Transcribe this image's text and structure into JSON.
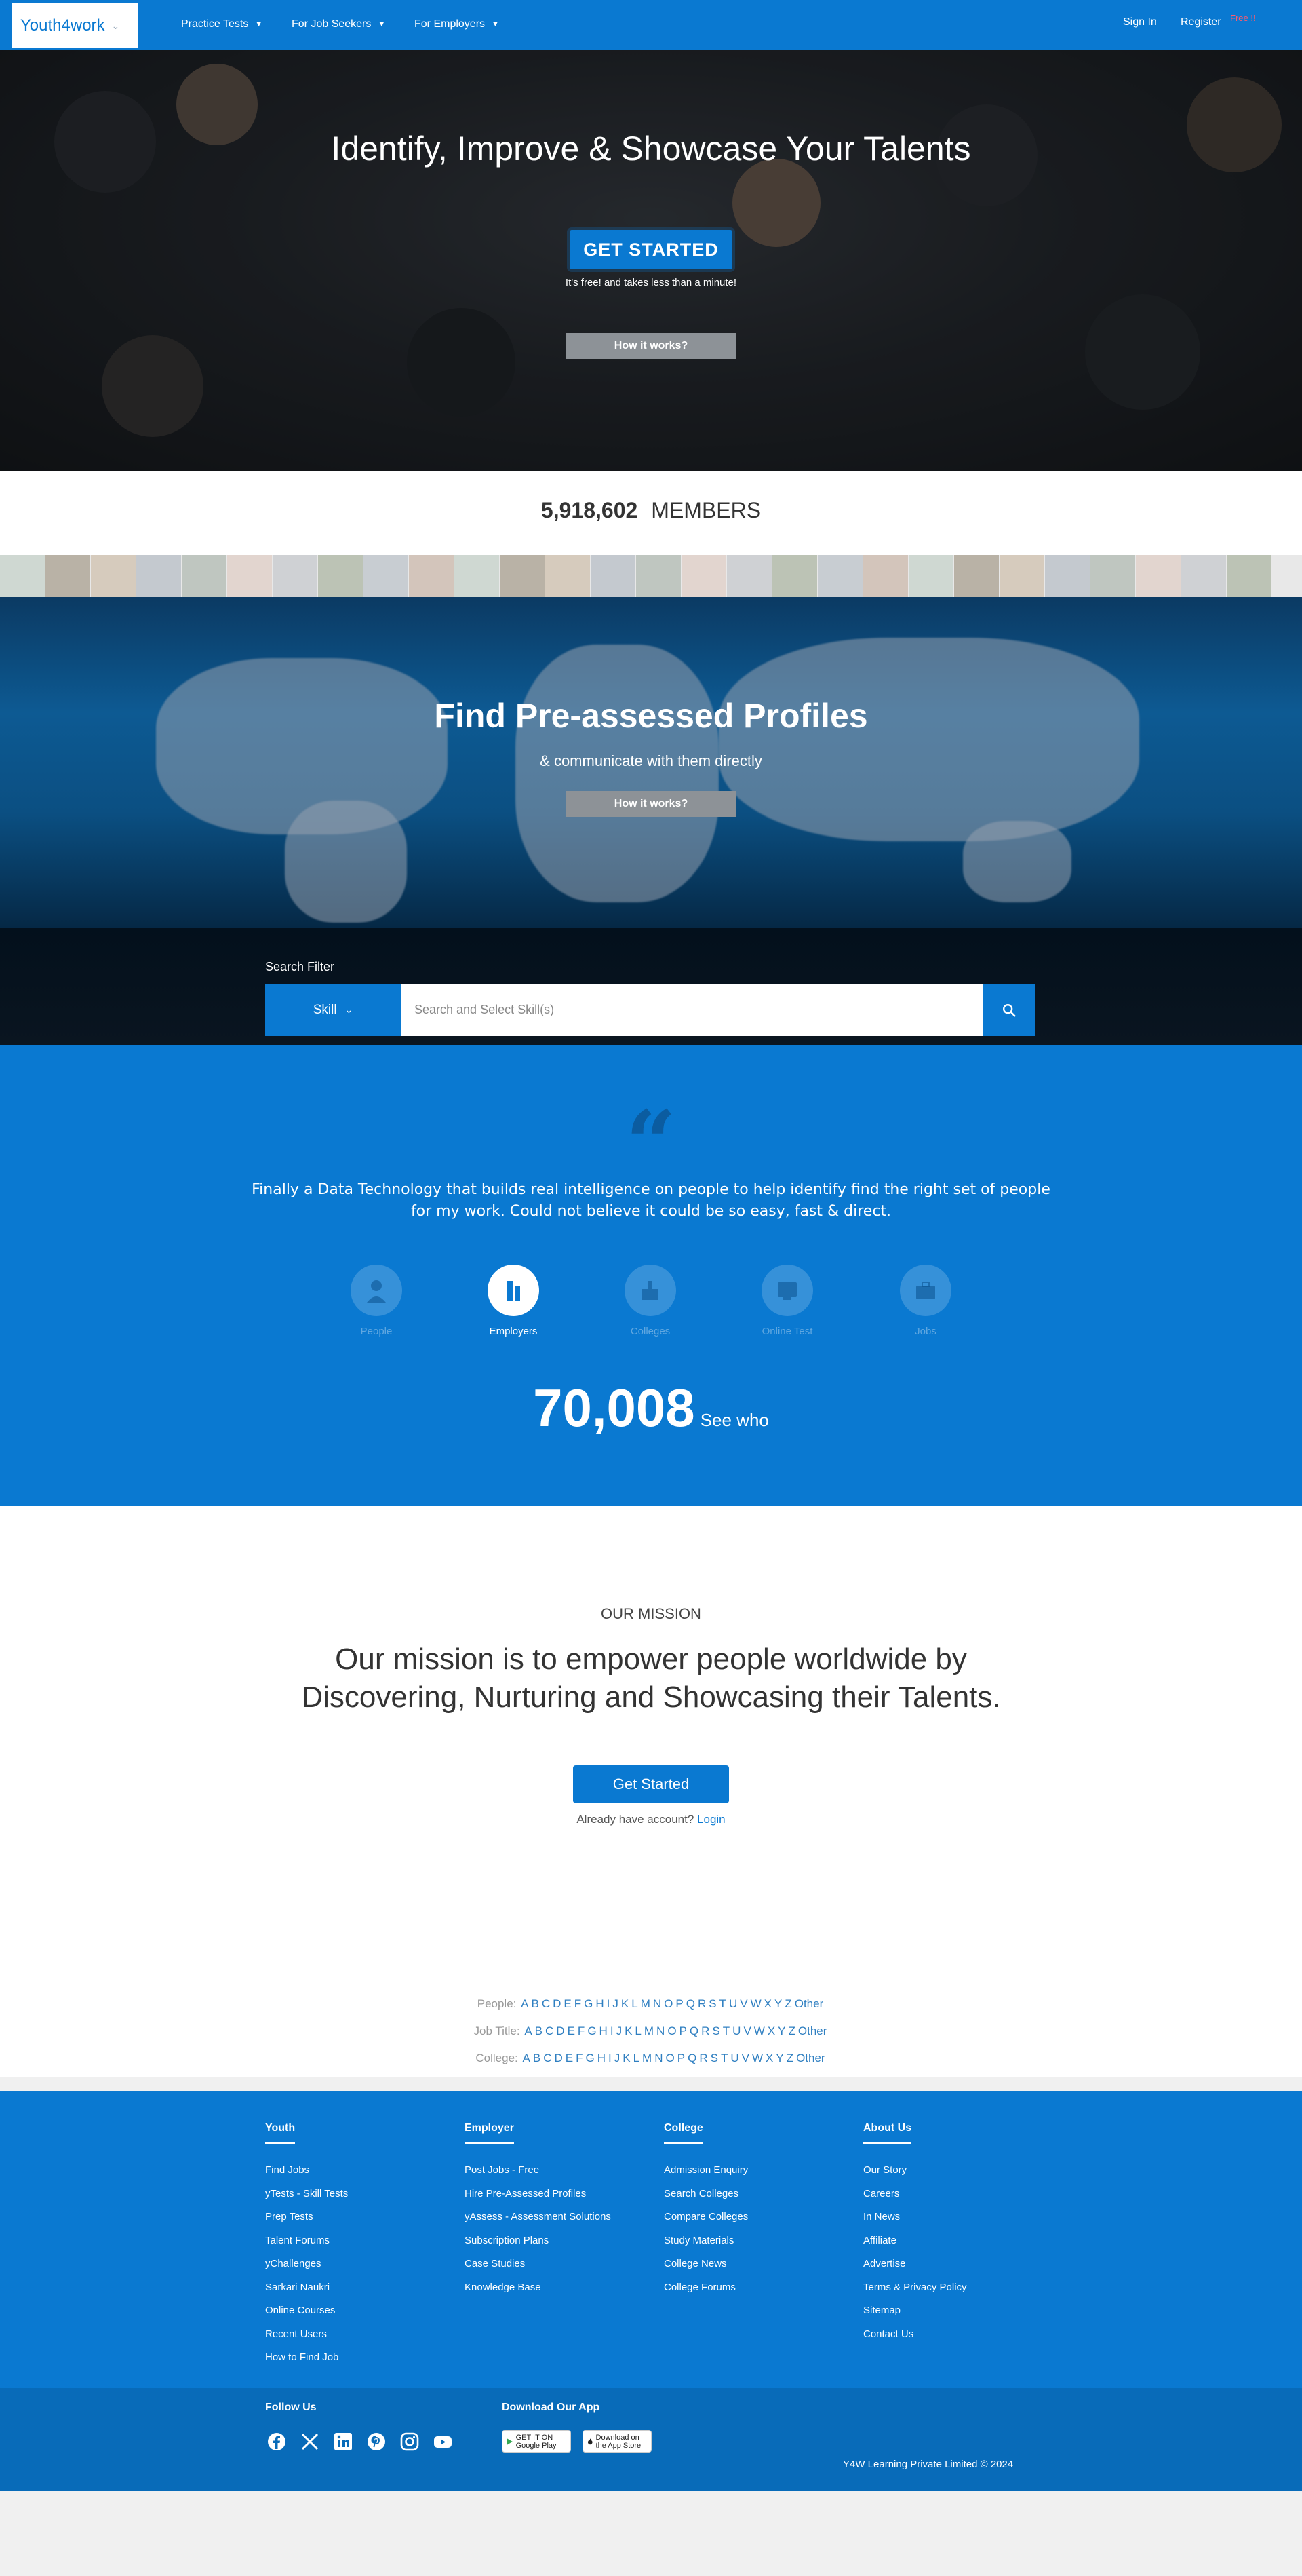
{
  "nav": {
    "logo": "Youth4work",
    "menu": [
      "Practice Tests",
      "For Job Seekers",
      "For Employers"
    ],
    "sign_in": "Sign In",
    "register": "Register",
    "free_tag": "Free !!"
  },
  "hero": {
    "title": "Identify, Improve & Showcase Your Talents",
    "cta": "GET STARTED",
    "subtitle": "It's free! and takes less than a minute!",
    "how_it_works": "How it works?"
  },
  "members": {
    "count": "5,918,602",
    "label": "MEMBERS"
  },
  "profiles": {
    "title": "Find Pre-assessed Profiles",
    "subtitle": "& communicate with them directly",
    "how_it_works": "How it works?"
  },
  "search": {
    "label": "Search Filter",
    "filter": "Skill",
    "placeholder": "Search and Select Skill(s)"
  },
  "testimonial": {
    "quote": "Finally a Data Technology that builds real intelligence on people to help identify find the right set of people for my work. Could not believe it could be so easy, fast & direct.",
    "categories": [
      "People",
      "Employers",
      "Colleges",
      "Online Test",
      "Jobs"
    ],
    "active_category": "Employers",
    "count": "70,008",
    "see_who": "See who"
  },
  "mission": {
    "kicker": "OUR MISSION",
    "line1": "Our mission is to empower people worldwide by",
    "line2": "Discovering, Nurturing and Showcasing their Talents.",
    "cta": "Get Started",
    "already": "Already have account?",
    "login": "Login"
  },
  "directory": {
    "rows": [
      {
        "label": "People:",
        "letters": [
          "A",
          "B",
          "C",
          "D",
          "E",
          "F",
          "G",
          "H",
          "I",
          "J",
          "K",
          "L",
          "M",
          "N",
          "O",
          "P",
          "Q",
          "R",
          "S",
          "T",
          "U",
          "V",
          "W",
          "X",
          "Y",
          "Z",
          "Other"
        ]
      },
      {
        "label": "Job Title:",
        "letters": [
          "A",
          "B",
          "C",
          "D",
          "E",
          "F",
          "G",
          "H",
          "I",
          "J",
          "K",
          "L",
          "M",
          "N",
          "O",
          "P",
          "Q",
          "R",
          "S",
          "T",
          "U",
          "V",
          "W",
          "X",
          "Y",
          "Z",
          "Other"
        ]
      },
      {
        "label": "College:",
        "letters": [
          "A",
          "B",
          "C",
          "D",
          "E",
          "F",
          "G",
          "H",
          "I",
          "J",
          "K",
          "L",
          "M",
          "N",
          "O",
          "P",
          "Q",
          "R",
          "S",
          "T",
          "U",
          "V",
          "W",
          "X",
          "Y",
          "Z",
          "Other"
        ]
      }
    ]
  },
  "footer": {
    "columns": [
      {
        "heading": "Youth",
        "links": [
          "Find Jobs",
          "yTests - Skill Tests",
          "Prep Tests",
          "Talent Forums",
          "yChallenges",
          "Sarkari Naukri",
          "Online Courses",
          "Recent Users",
          "How to Find Job"
        ]
      },
      {
        "heading": "Employer",
        "links": [
          "Post Jobs - Free",
          "Hire Pre-Assessed Profiles",
          "yAssess - Assessment Solutions",
          "Subscription Plans",
          "Case Studies",
          "Knowledge Base"
        ]
      },
      {
        "heading": "College",
        "links": [
          "Admission Enquiry",
          "Search Colleges",
          "Compare Colleges",
          "Study Materials",
          "College News",
          "College Forums"
        ]
      },
      {
        "heading": "About Us",
        "links": [
          "Our Story",
          "Careers",
          "In News",
          "Affiliate",
          "Advertise",
          "Terms & Privacy Policy",
          "Sitemap",
          "Contact Us"
        ]
      }
    ],
    "follow_us": "Follow Us",
    "social": [
      "facebook-icon",
      "x-icon",
      "linkedin-icon",
      "pinterest-icon",
      "instagram-icon",
      "youtube-icon"
    ],
    "download": "Download Our App",
    "google_play": "GET IT ON Google Play",
    "app_store": "Download on the App Store",
    "copyright": "Y4W Learning Private Limited © 2024"
  },
  "colors": {
    "brand": "#0a79d1",
    "free_tag": "#ff5a6e",
    "link": "#2f7fc1"
  }
}
